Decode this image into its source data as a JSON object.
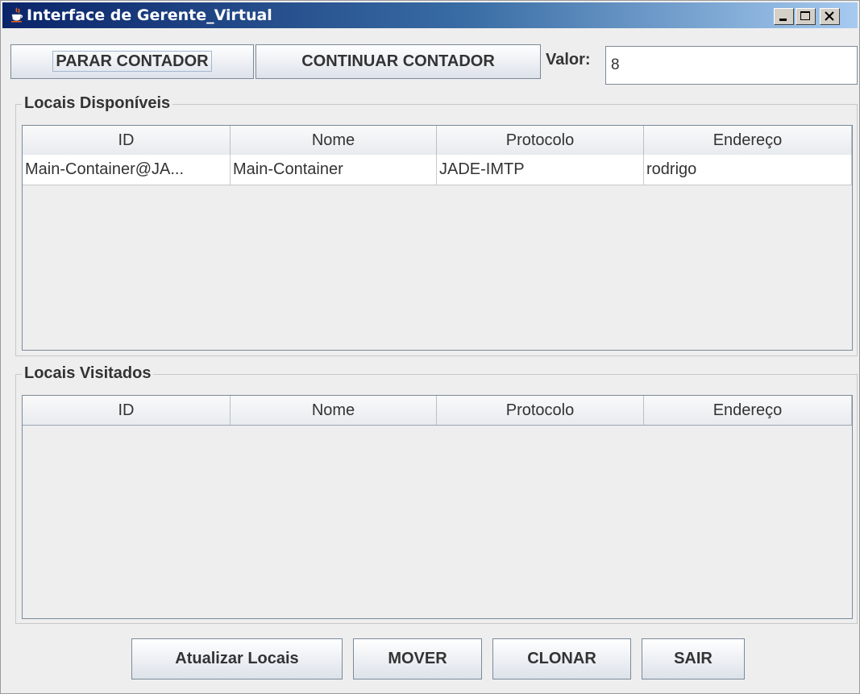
{
  "window": {
    "title": "Interface de Gerente_Virtual",
    "title_bar_colors": [
      "#0a246a",
      "#a6caf0"
    ]
  },
  "toolbar": {
    "stop_label": "PARAR CONTADOR",
    "continue_label": "CONTINUAR CONTADOR",
    "value_label": "Valor:",
    "value": "8"
  },
  "available": {
    "title": "Locais Disponíveis",
    "columns": [
      "ID",
      "Nome",
      "Protocolo",
      "Endereço"
    ],
    "rows": [
      [
        "Main-Container@JA...",
        "Main-Container",
        "JADE-IMTP",
        "rodrigo"
      ]
    ]
  },
  "visited": {
    "title": "Locais Visitados",
    "columns": [
      "ID",
      "Nome",
      "Protocolo",
      "Endereço"
    ],
    "rows": []
  },
  "actions": {
    "refresh_label": "Atualizar Locais",
    "move_label": "MOVER",
    "clone_label": "CLONAR",
    "exit_label": "SAIR"
  },
  "icons": {
    "app": "java-cup-icon",
    "minimize": "minimize-icon",
    "maximize": "maximize-icon",
    "close": "close-icon"
  }
}
